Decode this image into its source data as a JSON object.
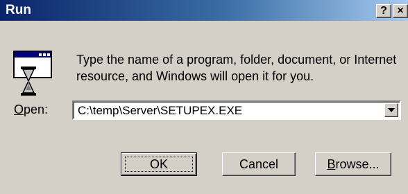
{
  "window": {
    "title": "Run",
    "help_button": "?",
    "close_button": "×"
  },
  "description": "Type the name of a program, folder, document, or Internet resource, and Windows will open it for you.",
  "open_field": {
    "label_accel": "O",
    "label_rest": "pen:",
    "value": "C:\\temp\\Server\\SETUPEX.EXE"
  },
  "buttons": {
    "ok": "OK",
    "cancel": "Cancel",
    "browse_accel": "B",
    "browse_rest": "rowse..."
  },
  "colors": {
    "face": "#d4d0c8",
    "title_start": "#0a246a",
    "title_end": "#a6caf0"
  }
}
